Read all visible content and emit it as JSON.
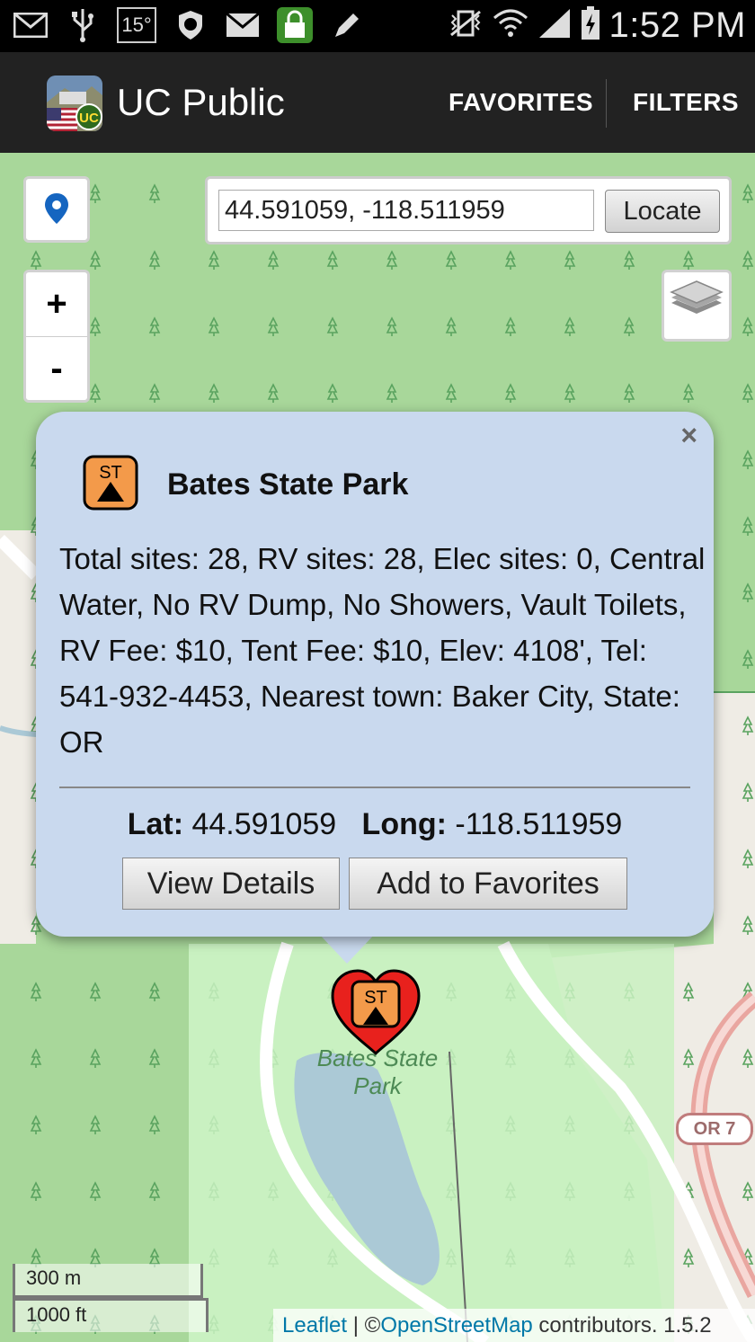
{
  "status_bar": {
    "temperature": "15°",
    "time": "1:52 PM"
  },
  "app_bar": {
    "title": "UC Public",
    "favorites_label": "FAVORITES",
    "filters_label": "FILTERS"
  },
  "map": {
    "locate": {
      "coordinate_value": "44.591059, -118.511959",
      "button_label": "Locate"
    },
    "zoom_in_label": "+",
    "zoom_out_label": "-",
    "road_shield": "OR 7",
    "place_label_line1": "Bates State",
    "place_label_line2": "Park",
    "scale": {
      "metric": "300 m",
      "imperial": "1000 ft"
    },
    "attribution": {
      "leaflet": "Leaflet",
      "separator": " | ©",
      "osm": "OpenStreetMap",
      "suffix": " contributors. 1.5.2"
    },
    "colors": {
      "forest": "#a8d79a",
      "park": "#c8f2c4",
      "land": "#f0ede6",
      "water": "#abc9d6",
      "road": "#ffffff",
      "highway": "#e9a6a0"
    }
  },
  "popup": {
    "close_label": "×",
    "icon_text": "ST",
    "title": "Bates State Park",
    "description": "Total sites: 28, RV sites: 28, Elec sites: 0, Central Water, No RV Dump, No Showers, Vault Toilets, RV Fee: $10, Tent Fee: $10, Elev: 4108', Tel: 541-932-4453, Nearest town: Baker City, State: OR",
    "lat_label": "Lat:",
    "lat_value": "44.591059",
    "long_label": "Long:",
    "long_value": "-118.511959",
    "view_details_label": "View Details",
    "add_favorites_label": "Add to Favorites"
  },
  "marker": {
    "icon_text": "ST",
    "color": "#e8211d"
  }
}
